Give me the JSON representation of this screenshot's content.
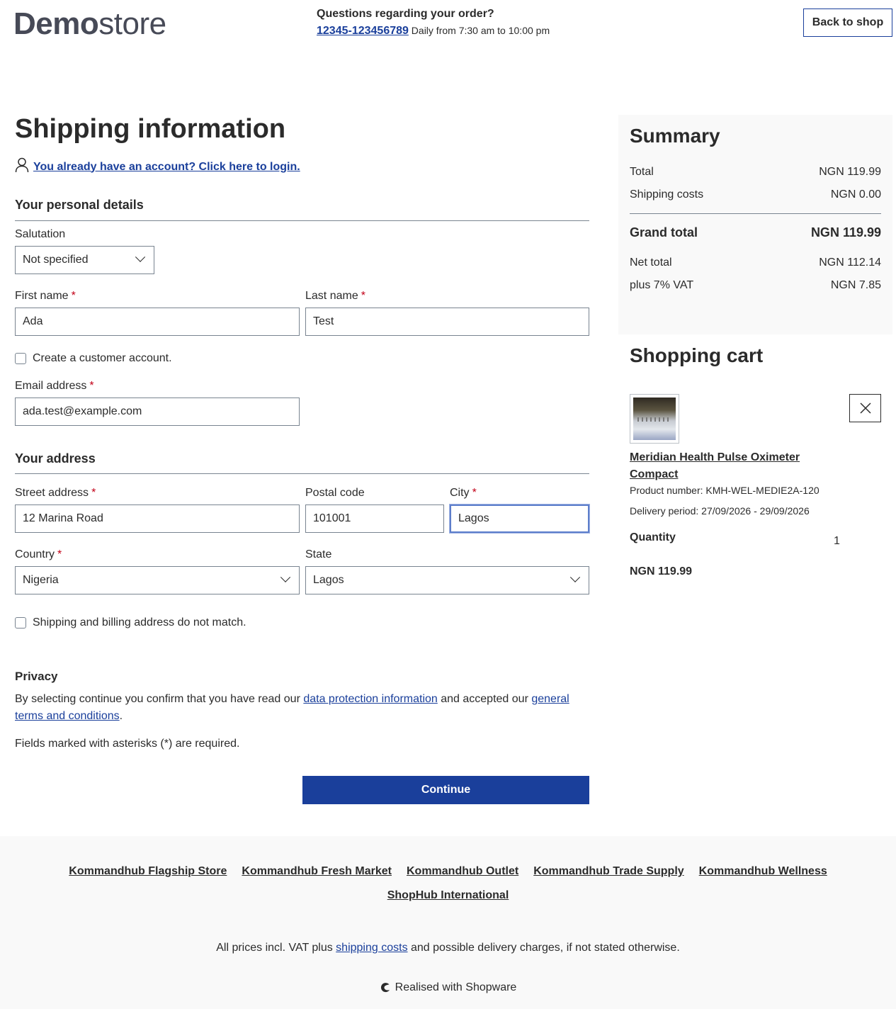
{
  "header": {
    "logo_bold": "Demo",
    "logo_light": "store",
    "question_title": "Questions regarding your order?",
    "phone": "12345-123456789",
    "hours": "Daily from 7:30 am to 10:00 pm",
    "back_label": "Back to shop"
  },
  "form": {
    "title": "Shipping information",
    "login_link": "You already have an account? Click here to login.",
    "personal_title": "Your personal details",
    "salutation_label": "Salutation",
    "salutation_value": "Not specified",
    "first_name_label": "First name",
    "first_name_value": "Ada",
    "last_name_label": "Last name",
    "last_name_value": "Test",
    "create_account_label": "Create a customer account.",
    "email_label": "Email address",
    "email_value": "ada.test@example.com",
    "address_title": "Your address",
    "street_label": "Street address",
    "street_value": "12 Marina Road",
    "postal_label": "Postal code",
    "postal_value": "101001",
    "city_label": "City",
    "city_value": "Lagos",
    "country_label": "Country",
    "country_value": "Nigeria",
    "state_label": "State",
    "state_value": "Lagos",
    "billing_mismatch_label": "Shipping and billing address do not match.",
    "required_marker": "*",
    "privacy_title": "Privacy",
    "privacy_pre": "By selecting continue you confirm that you have read our ",
    "privacy_link1": "data protection information",
    "privacy_mid": " and accepted our ",
    "privacy_link2": "general terms and conditions",
    "privacy_post": ".",
    "required_note": "Fields marked with asterisks (*) are required.",
    "continue_label": "Continue"
  },
  "summary": {
    "title": "Summary",
    "total_label": "Total",
    "total_value": "NGN 119.99",
    "shipping_label": "Shipping costs",
    "shipping_value": "NGN 0.00",
    "grand_label": "Grand total",
    "grand_value": "NGN 119.99",
    "net_label": "Net total",
    "net_value": "NGN 112.14",
    "vat_label": "plus 7% VAT",
    "vat_value": "NGN 7.85"
  },
  "cart": {
    "title": "Shopping cart",
    "product_name": "Meridian Health Pulse Oximeter Compact",
    "product_number": "Product number: KMH-WEL-MEDIE2A-120",
    "delivery": "Delivery period: 27/09/2026 - 29/09/2026",
    "quantity_label": "Quantity",
    "quantity_value": "1",
    "price": "NGN 119.99"
  },
  "footer": {
    "links": [
      "Kommandhub Flagship Store",
      "Kommandhub Fresh Market",
      "Kommandhub Outlet",
      "Kommandhub Trade Supply",
      "Kommandhub Wellness",
      "ShopHub International"
    ],
    "vat_pre": "All prices incl. VAT plus ",
    "vat_link": "shipping costs",
    "vat_post": " and possible delivery charges, if not stated otherwise.",
    "realised": "Realised with Shopware"
  },
  "colors": {
    "primary": "#1a3f9b",
    "required": "#c20017",
    "text": "#2b2b2b",
    "panel_bg": "#f9f9f9"
  },
  "icons": [
    "user-icon",
    "chevron-down-icon",
    "close-icon",
    "shopware-icon"
  ]
}
